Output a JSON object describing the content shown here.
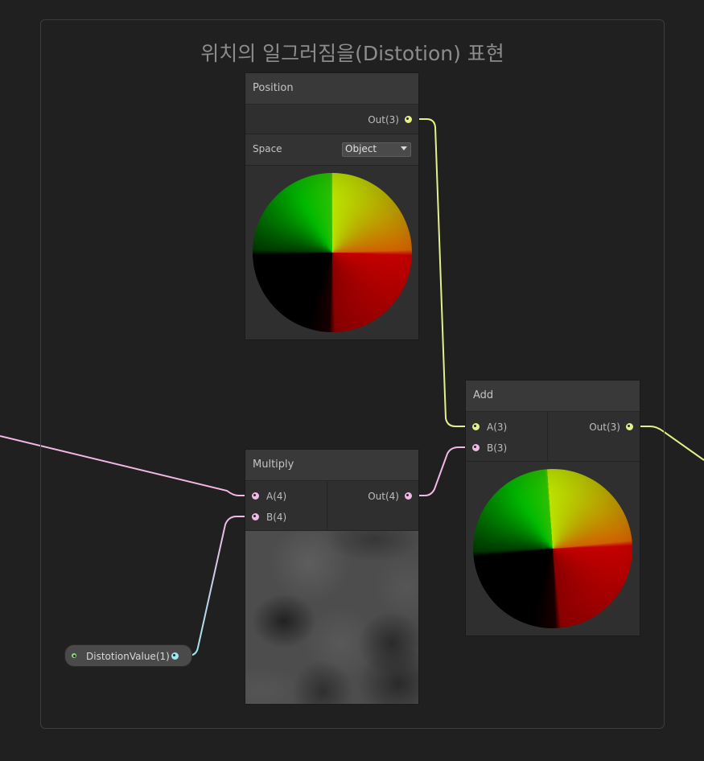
{
  "group": {
    "title": "위치의  일그러짐을(Distotion) 표현"
  },
  "position_node": {
    "title": "Position",
    "output": "Out(3)",
    "space_label": "Space",
    "space_value": "Object"
  },
  "add_node": {
    "title": "Add",
    "input_a": "A(3)",
    "input_b": "B(3)",
    "output": "Out(3)"
  },
  "multiply_node": {
    "title": "Multiply",
    "input_a": "A(4)",
    "input_b": "B(4)",
    "output": "Out(4)"
  },
  "property_node": {
    "label": "DistotionValue(1)"
  },
  "colors": {
    "wire_vector3": "#e6f08a",
    "wire_vector4": "#f2b8e6",
    "wire_vector1": "#9de6f0",
    "background": "#202020"
  }
}
